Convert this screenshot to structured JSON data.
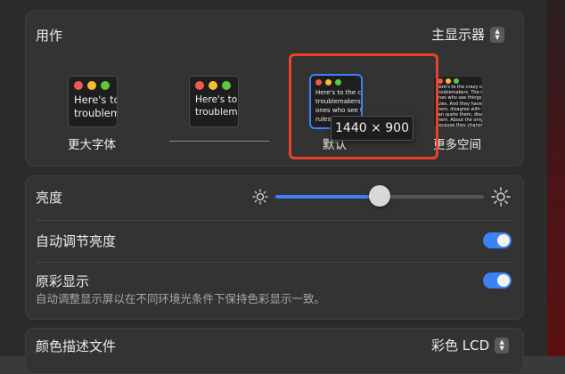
{
  "usage": {
    "label": "用作",
    "select_value": "主显示器"
  },
  "resolutions": {
    "options": [
      {
        "label": "更大字体",
        "text": "Here's to\ntroublem"
      },
      {
        "label": "",
        "text": "Here's to\ntroublema"
      },
      {
        "label": "默认",
        "text": "Here's to the cr\ntroublemakers.\nones who see t\nrules. And th"
      },
      {
        "label": "更多空间",
        "text": "Here's to the crazy one\ntroublemakers. The rou\nones who see things di\nrules. And they have no\nthem, disagree with the\ncan quote them, disagre\nthem. About the only th\nBecause they change th\nthey push the human ra"
      }
    ],
    "tooltip": "1440 × 900"
  },
  "brightness": {
    "label": "亮度",
    "level": 0.5
  },
  "auto_brightness": {
    "label": "自动调节亮度",
    "on": true
  },
  "true_tone": {
    "label": "原彩显示",
    "description": "自动调整显示屏以在不同环境光条件下保持色彩显示一致。",
    "on": true
  },
  "color_profile": {
    "label": "颜色描述文件",
    "select_value": "彩色 LCD"
  },
  "colors": {
    "accent": "#3b82f6",
    "highlight": "#e8422b",
    "traffic_red": "#ee5b4f",
    "traffic_yellow": "#f5bd2f",
    "traffic_green": "#5fc63f"
  }
}
